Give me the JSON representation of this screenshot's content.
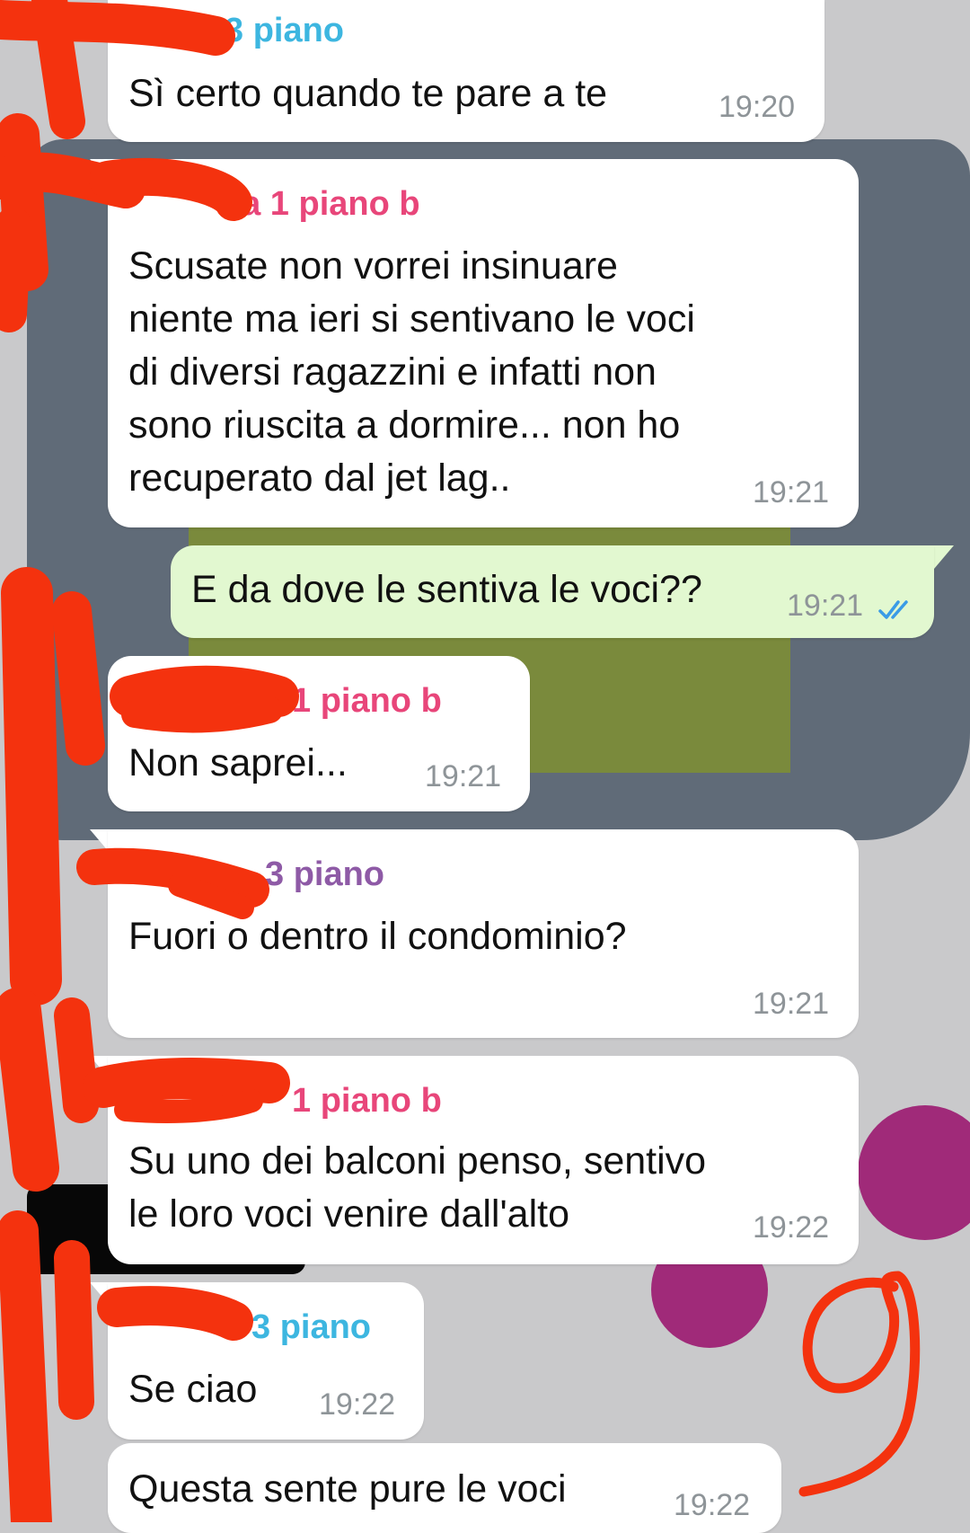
{
  "colors": {
    "sender_cyan": "#3db6e0",
    "sender_pink": "#e8467a",
    "sender_purple": "#8e5aa6",
    "outgoing_bubble": "#e2f8d0",
    "incoming_bubble": "#ffffff",
    "read_ticks": "#3a9be6",
    "redaction_marker": "#f4320e"
  },
  "messages": [
    {
      "sender": "3 piano",
      "text": "Sì certo quando te pare a te",
      "time": "19:20"
    },
    {
      "sender": "lla 1 piano b",
      "text": "Scusate non vorrei insinuare\nniente ma ieri si sentivano le voci\ndi diversi ragazzini e infatti non\nsono riuscita a dormire... non ho\nrecuperato dal jet lag..",
      "time": "19:21"
    },
    {
      "text": "E da dove le sentiva le voci??",
      "time": "19:21",
      "status": "read-double-tick-icon"
    },
    {
      "sender": "1 piano b",
      "text": "Non saprei...",
      "time": "19:21"
    },
    {
      "sender": "3 piano",
      "text": "Fuori o dentro il condominio?",
      "time": "19:21"
    },
    {
      "sender": "1 piano b",
      "text": "Su uno dei balconi penso, sentivo\nle loro voci venire dall'alto",
      "time": "19:22"
    },
    {
      "sender": "3 piano",
      "text": "Se ciao",
      "time": "19:22"
    },
    {
      "text": "Questa sente pure le voci",
      "time": "19:22"
    }
  ]
}
